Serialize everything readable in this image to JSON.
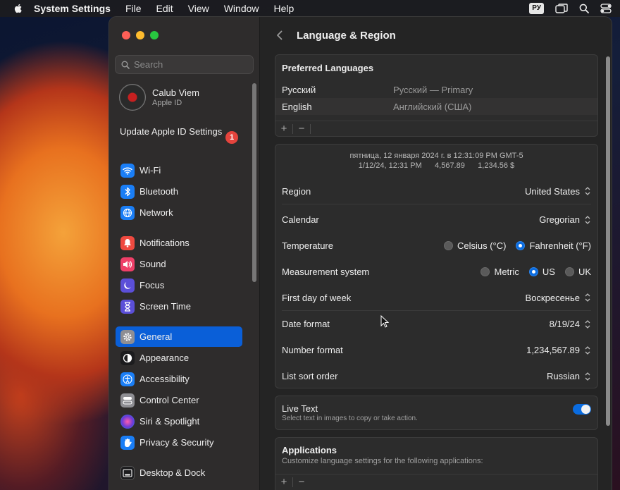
{
  "menubar": {
    "app_name": "System Settings",
    "items": [
      "File",
      "Edit",
      "View",
      "Window",
      "Help"
    ],
    "input_source": "РУ"
  },
  "sidebar": {
    "search_placeholder": "Search",
    "profile": {
      "name": "Calub Viem",
      "subtitle": "Apple ID"
    },
    "update": {
      "label": "Update Apple ID Settings",
      "badge": "1"
    },
    "items": [
      {
        "label": "Wi-Fi",
        "icon": "wifi-icon",
        "color": "#1a7ef6"
      },
      {
        "label": "Bluetooth",
        "icon": "bluetooth-icon",
        "color": "#1a7ef6"
      },
      {
        "label": "Network",
        "icon": "globe-icon",
        "color": "#1a7ef6"
      },
      {
        "label": "Notifications",
        "icon": "bell-icon",
        "color": "#ef4a40"
      },
      {
        "label": "Sound",
        "icon": "speaker-icon",
        "color": "#ef3f68"
      },
      {
        "label": "Focus",
        "icon": "moon-icon",
        "color": "#5b4fd8"
      },
      {
        "label": "Screen Time",
        "icon": "hourglass-icon",
        "color": "#5b4fd8"
      },
      {
        "label": "General",
        "icon": "gear-icon",
        "color": "#8e8e93"
      },
      {
        "label": "Appearance",
        "icon": "appearance-icon",
        "color": "#1c1c1e"
      },
      {
        "label": "Accessibility",
        "icon": "accessibility-icon",
        "color": "#1a7ef6"
      },
      {
        "label": "Control Center",
        "icon": "control-center-icon",
        "color": "#8e8e93"
      },
      {
        "label": "Siri & Spotlight",
        "icon": "siri-icon",
        "color": "#6c3ad6"
      },
      {
        "label": "Privacy & Security",
        "icon": "hand-icon",
        "color": "#1a7ef6"
      },
      {
        "label": "Desktop & Dock",
        "icon": "dock-icon",
        "color": "#1c1c1e"
      }
    ],
    "active_item": "General"
  },
  "main": {
    "title": "Language & Region",
    "preferred_languages": {
      "title": "Preferred Languages",
      "rows": [
        {
          "name": "Русский",
          "detail": "Русский — Primary"
        },
        {
          "name": "English",
          "detail": "Английский (США)"
        }
      ],
      "add": "+",
      "remove": "−"
    },
    "format_preview": {
      "line1": "пятница, 12 января 2024 г. в 12:31:09 PM GMT-5",
      "line2": "1/12/24, 12:31 PM      4,567.89      1,234.56 $"
    },
    "settings": {
      "region": {
        "label": "Region",
        "value": "United States"
      },
      "calendar": {
        "label": "Calendar",
        "value": "Gregorian"
      },
      "temperature": {
        "label": "Temperature",
        "options": [
          "Celsius (°C)",
          "Fahrenheit (°F)"
        ],
        "selected": "Fahrenheit (°F)"
      },
      "measurement": {
        "label": "Measurement system",
        "options": [
          "Metric",
          "US",
          "UK"
        ],
        "selected": "US"
      },
      "first_day": {
        "label": "First day of week",
        "value": "Воскресенье"
      },
      "date_format": {
        "label": "Date format",
        "value": "8/19/24"
      },
      "number_format": {
        "label": "Number format",
        "value": "1,234,567.89"
      },
      "sort_order": {
        "label": "List sort order",
        "value": "Russian"
      }
    },
    "live_text": {
      "label": "Live Text",
      "description": "Select text in images to copy or take action.",
      "enabled": true
    },
    "applications": {
      "title": "Applications",
      "description": "Customize language settings for the following applications:",
      "add": "+",
      "remove": "−"
    }
  }
}
